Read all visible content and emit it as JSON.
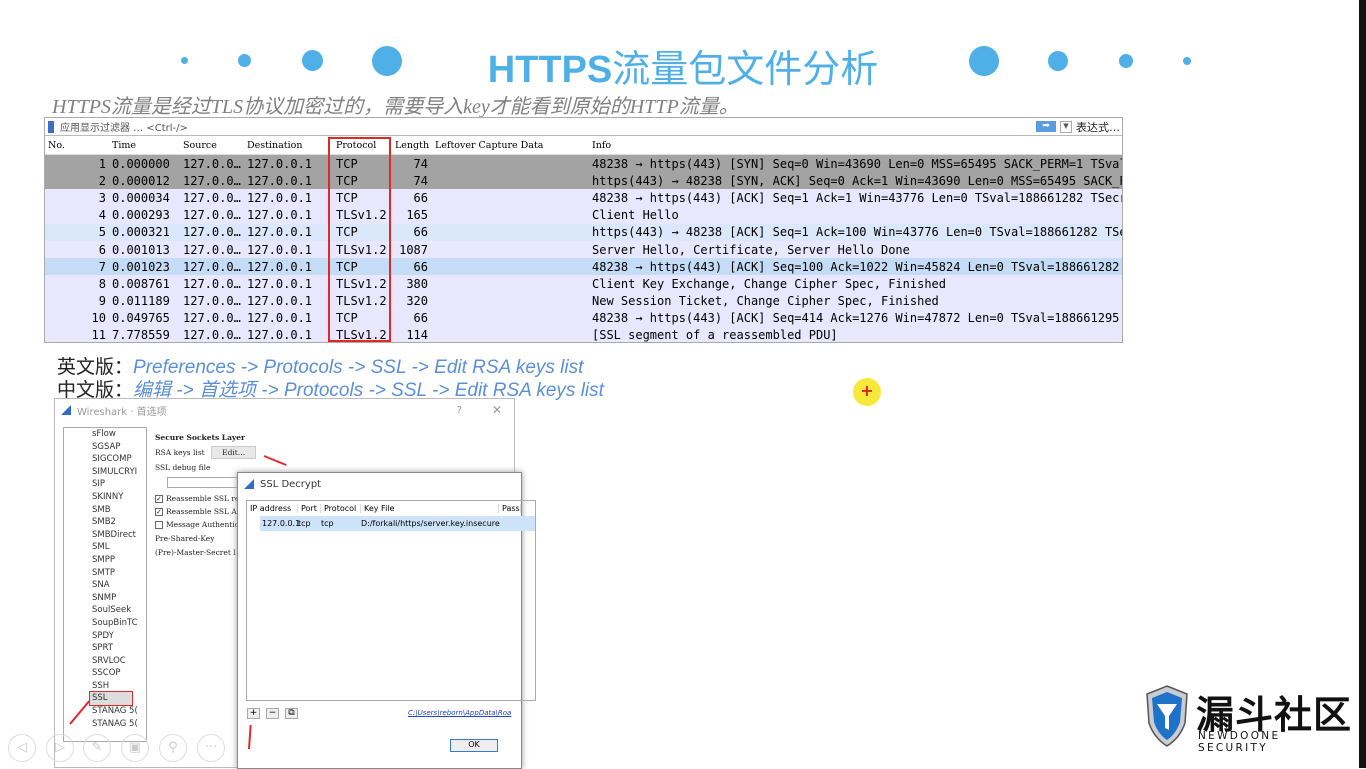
{
  "slide": {
    "title_bold": "HTTPS",
    "title_rest": "流量包文件分析",
    "subtitle": "HTTPS流量是经过TLS协议加密过的，需要导入key才能看到原始的HTTP流量。",
    "en_label": "英文版：",
    "en_path": "Preferences -> Protocols -> SSL -> Edit RSA keys list",
    "cn_label": "中文版：",
    "cn_path": "编辑 -> 首选项 -> Protocols -> SSL -> Edit RSA keys list",
    "accent": "#4fb0e8"
  },
  "wireshark": {
    "filter_placeholder": "应用显示过滤器 … <Ctrl-/>",
    "expression": "表达式…",
    "columns": [
      "No.",
      "Time",
      "Source",
      "Destination",
      "Protocol",
      "Length",
      "Leftover Capture Data",
      "Info"
    ],
    "rows": [
      [
        "1",
        "0.000000",
        "127.0.0…",
        "127.0.0.1",
        "TCP",
        "74",
        "",
        "48238 → https(443) [SYN] Seq=0 Win=43690 Len=0 MSS=65495 SACK_PERM=1 TSval…"
      ],
      [
        "2",
        "0.000012",
        "127.0.0…",
        "127.0.0.1",
        "TCP",
        "74",
        "",
        "https(443) → 48238 [SYN, ACK] Seq=0 Ack=1 Win=43690 Len=0 MSS=65495 SACK_P…"
      ],
      [
        "3",
        "0.000034",
        "127.0.0…",
        "127.0.0.1",
        "TCP",
        "66",
        "",
        "48238 → https(443) [ACK] Seq=1 Ack=1 Win=43776 Len=0 TSval=188661282 TSecr…"
      ],
      [
        "4",
        "0.000293",
        "127.0.0…",
        "127.0.0.1",
        "TLSv1.2",
        "165",
        "",
        "Client Hello"
      ],
      [
        "5",
        "0.000321",
        "127.0.0…",
        "127.0.0.1",
        "TCP",
        "66",
        "",
        "https(443) → 48238 [ACK] Seq=1 Ack=100 Win=43776 Len=0 TSval=188661282 TSe…"
      ],
      [
        "6",
        "0.001013",
        "127.0.0…",
        "127.0.0.1",
        "TLSv1.2",
        "1087",
        "",
        "Server Hello, Certificate, Server Hello Done"
      ],
      [
        "7",
        "0.001023",
        "127.0.0…",
        "127.0.0.1",
        "TCP",
        "66",
        "",
        "48238 → https(443) [ACK] Seq=100 Ack=1022 Win=45824 Len=0 TSval=188661282 …"
      ],
      [
        "8",
        "0.008761",
        "127.0.0…",
        "127.0.0.1",
        "TLSv1.2",
        "380",
        "",
        "Client Key Exchange, Change Cipher Spec, Finished"
      ],
      [
        "9",
        "0.011189",
        "127.0.0…",
        "127.0.0.1",
        "TLSv1.2",
        "320",
        "",
        "New Session Ticket, Change Cipher Spec, Finished"
      ],
      [
        "10",
        "0.049765",
        "127.0.0…",
        "127.0.0.1",
        "TCP",
        "66",
        "",
        "48238 → https(443) [ACK] Seq=414 Ack=1276 Win=47872 Len=0 TSval=188661295 …"
      ],
      [
        "11",
        "7.778559",
        "127.0.0…",
        "127.0.0.1",
        "TLSv1.2",
        "114",
        "",
        "[SSL segment of a reassembled PDU]"
      ]
    ]
  },
  "prefs": {
    "title": "Wireshark · 首选项",
    "help": "?",
    "close": "✕",
    "protocols": [
      "sFlow",
      "SGSAP",
      "SIGCOMP",
      "SIMULCRYI",
      "SIP",
      "SKINNY",
      "SMB",
      "SMB2",
      "SMBDirect",
      "SML",
      "SMPP",
      "SMTP",
      "SNA",
      "SNMP",
      "SoulSeek",
      "SoupBinTC",
      "SPDY",
      "SPRT",
      "SRVLOC",
      "SSCOP",
      "SSH",
      "SSL",
      "STANAG 5(",
      "STANAG 5("
    ],
    "section": "Secure Sockets Layer",
    "rsa_label": "RSA keys list",
    "edit_btn": "Edit…",
    "debug_label": "SSL debug file",
    "cb1": "Reassemble SSL rec",
    "cb2": "Reassemble SSL App",
    "cb3": "Message Authentic",
    "psk_label": "Pre-Shared-Key",
    "master_label": "(Pre)-Master-Secret l"
  },
  "decrypt": {
    "title": "SSL Decrypt",
    "columns": [
      "IP address",
      "Port",
      "Protocol",
      "Key File",
      "Pass"
    ],
    "row": [
      "127.0.0.1",
      "tcp",
      "tcp",
      "D:/forkali/https/server.key.insecure"
    ],
    "add": "+",
    "remove": "−",
    "copy": "⧉",
    "path_link": "C:\\Users\\reborn\\AppData\\Roa",
    "ok": "OK"
  },
  "logo": {
    "cn": "漏斗社区",
    "en": "NEWDOONE SECURITY"
  }
}
